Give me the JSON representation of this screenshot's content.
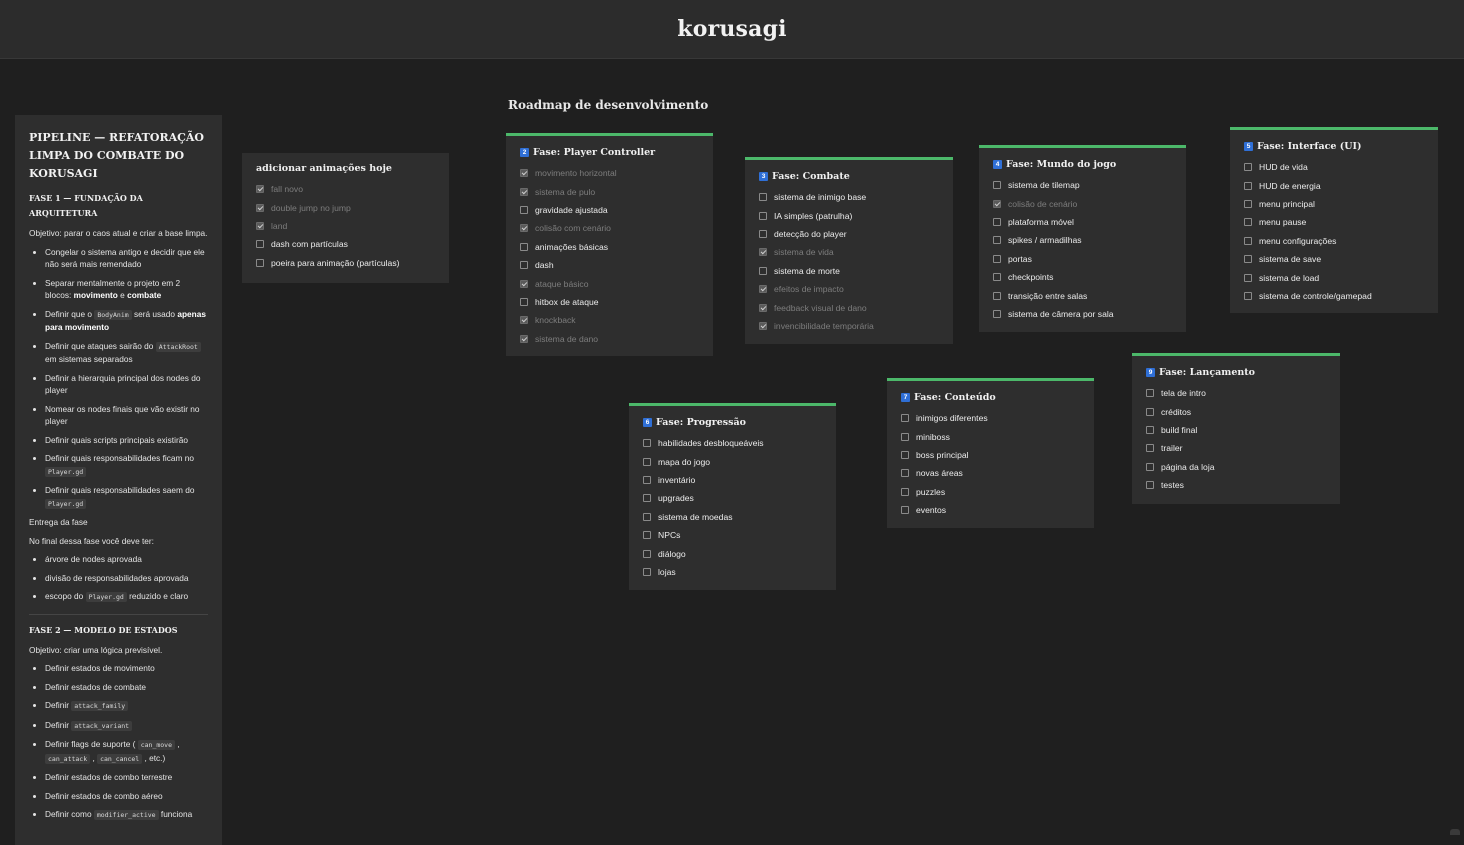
{
  "app": {
    "title": "korusagi"
  },
  "roadmap": {
    "title": "Roadmap de desenvolvimento"
  },
  "pipeline": {
    "title": "PIPELINE — REFATORAÇÃO LIMPA DO COMBATE DO KORUSAGI",
    "phase1": {
      "heading": "FASE 1 — FUNDAÇÃO DA ARQUITETURA",
      "objective": "Objetivo: parar o caos atual e criar a base limpa.",
      "items": [
        {
          "a": "Congelar o sistema antigo e decidir que ele não será mais remendado"
        },
        {
          "a": "Separar mentalmente o projeto em 2 blocos: ",
          "b1": "movimento",
          "c": " e ",
          "b2": "combate"
        },
        {
          "a": "Definir que o ",
          "code": "BodyAnim",
          "c": " será usado ",
          "b1": "apenas para movimento"
        },
        {
          "a": "Definir que ataques sairão do ",
          "code": "AttackRoot",
          "c": " em sistemas separados"
        },
        {
          "a": "Definir a hierarquia principal dos nodes do player"
        },
        {
          "a": "Nomear os nodes finais que vão existir no player"
        },
        {
          "a": "Definir quais scripts principais existirão"
        },
        {
          "a": "Definir quais responsabilidades ficam no ",
          "code": "Player.gd"
        },
        {
          "a": "Definir quais responsabilidades saem do ",
          "code": "Player.gd"
        }
      ],
      "delivery": "Entrega da fase",
      "end_text": "No final dessa fase você deve ter:",
      "end_items": [
        {
          "a": "árvore de nodes aprovada"
        },
        {
          "a": "divisão de responsabilidades aprovada"
        },
        {
          "a": "escopo do ",
          "code": "Player.gd",
          "c": " reduzido e claro"
        }
      ]
    },
    "phase2": {
      "heading": "FASE 2 — MODELO DE ESTADOS",
      "objective": "Objetivo: criar uma lógica previsível.",
      "items": [
        {
          "a": "Definir estados de movimento"
        },
        {
          "a": "Definir estados de combate"
        },
        {
          "a": "Definir ",
          "code": "attack_family"
        },
        {
          "a": "Definir ",
          "code": "attack_variant"
        },
        {
          "a": "Definir flags de suporte ( ",
          "code": "can_move",
          "c": " , ",
          "code2": "can_attack",
          "d": " , ",
          "code3": "can_cancel",
          "e": " , etc.)"
        },
        {
          "a": "Definir estados de combo terrestre"
        },
        {
          "a": "Definir estados de combo aéreo"
        },
        {
          "a": "Definir como ",
          "code": "modifier_active",
          "c": " funciona"
        }
      ]
    }
  },
  "cards": [
    {
      "id": "anim",
      "badge": "",
      "title": "adicionar animações hoje",
      "accent": false,
      "items": [
        {
          "label": "fall novo",
          "checked": true
        },
        {
          "label": "double jump no jump",
          "checked": true
        },
        {
          "label": "land",
          "checked": true
        },
        {
          "label": "dash com partículas",
          "checked": false
        },
        {
          "label": "poeira para animação (partículas)",
          "checked": false
        }
      ]
    },
    {
      "id": "player",
      "badge": "2",
      "title": "Fase: Player Controller",
      "accent": true,
      "items": [
        {
          "label": "movimento horizontal",
          "checked": true
        },
        {
          "label": "sistema de pulo",
          "checked": true
        },
        {
          "label": "gravidade ajustada",
          "checked": false
        },
        {
          "label": "colisão com cenário",
          "checked": true
        },
        {
          "label": "animações básicas",
          "checked": false
        },
        {
          "label": "dash",
          "checked": false
        },
        {
          "label": "ataque básico",
          "checked": true
        },
        {
          "label": "hitbox de ataque",
          "checked": false
        },
        {
          "label": "knockback",
          "checked": true
        },
        {
          "label": "sistema de dano",
          "checked": true
        }
      ]
    },
    {
      "id": "combate",
      "badge": "3",
      "title": "Fase: Combate",
      "accent": true,
      "items": [
        {
          "label": "sistema de inimigo base",
          "checked": false
        },
        {
          "label": "IA simples (patrulha)",
          "checked": false
        },
        {
          "label": "detecção do player",
          "checked": false
        },
        {
          "label": "sistema de vida",
          "checked": true
        },
        {
          "label": "sistema de morte",
          "checked": false
        },
        {
          "label": "efeitos de impacto",
          "checked": true
        },
        {
          "label": "feedback visual de dano",
          "checked": true
        },
        {
          "label": "invencibilidade temporária",
          "checked": true
        }
      ]
    },
    {
      "id": "mundo",
      "badge": "4",
      "title": "Fase: Mundo do jogo",
      "accent": true,
      "items": [
        {
          "label": "sistema de tilemap",
          "checked": false
        },
        {
          "label": "colisão de cenário",
          "checked": true
        },
        {
          "label": "plataforma móvel",
          "checked": false
        },
        {
          "label": "spikes / armadilhas",
          "checked": false
        },
        {
          "label": "portas",
          "checked": false
        },
        {
          "label": "checkpoints",
          "checked": false
        },
        {
          "label": "transição entre salas",
          "checked": false
        },
        {
          "label": "sistema de câmera por sala",
          "checked": false
        }
      ]
    },
    {
      "id": "ui",
      "badge": "5",
      "title": "Fase: Interface (UI)",
      "accent": true,
      "items": [
        {
          "label": "HUD de vida",
          "checked": false
        },
        {
          "label": "HUD de energia",
          "checked": false
        },
        {
          "label": "menu principal",
          "checked": false
        },
        {
          "label": "menu pause",
          "checked": false
        },
        {
          "label": "menu configurações",
          "checked": false
        },
        {
          "label": "sistema de save",
          "checked": false
        },
        {
          "label": "sistema de load",
          "checked": false
        },
        {
          "label": "sistema de controle/gamepad",
          "checked": false
        }
      ]
    },
    {
      "id": "progressao",
      "badge": "6",
      "title": "Fase: Progressão",
      "accent": true,
      "items": [
        {
          "label": "habilidades desbloqueáveis",
          "checked": false
        },
        {
          "label": "mapa do jogo",
          "checked": false
        },
        {
          "label": "inventário",
          "checked": false
        },
        {
          "label": "upgrades",
          "checked": false
        },
        {
          "label": "sistema de moedas",
          "checked": false
        },
        {
          "label": "NPCs",
          "checked": false
        },
        {
          "label": "diálogo",
          "checked": false
        },
        {
          "label": "lojas",
          "checked": false
        }
      ]
    },
    {
      "id": "conteudo",
      "badge": "7",
      "title": "Fase: Conteúdo",
      "accent": true,
      "items": [
        {
          "label": "inimigos diferentes",
          "checked": false
        },
        {
          "label": "miniboss",
          "checked": false
        },
        {
          "label": "boss principal",
          "checked": false
        },
        {
          "label": "novas áreas",
          "checked": false
        },
        {
          "label": "puzzles",
          "checked": false
        },
        {
          "label": "eventos",
          "checked": false
        }
      ]
    },
    {
      "id": "lancamento",
      "badge": "9",
      "title": "Fase: Lançamento",
      "accent": true,
      "items": [
        {
          "label": "tela de intro",
          "checked": false
        },
        {
          "label": "créditos",
          "checked": false
        },
        {
          "label": "build final",
          "checked": false
        },
        {
          "label": "trailer",
          "checked": false
        },
        {
          "label": "página da loja",
          "checked": false
        },
        {
          "label": "testes",
          "checked": false
        }
      ]
    }
  ]
}
